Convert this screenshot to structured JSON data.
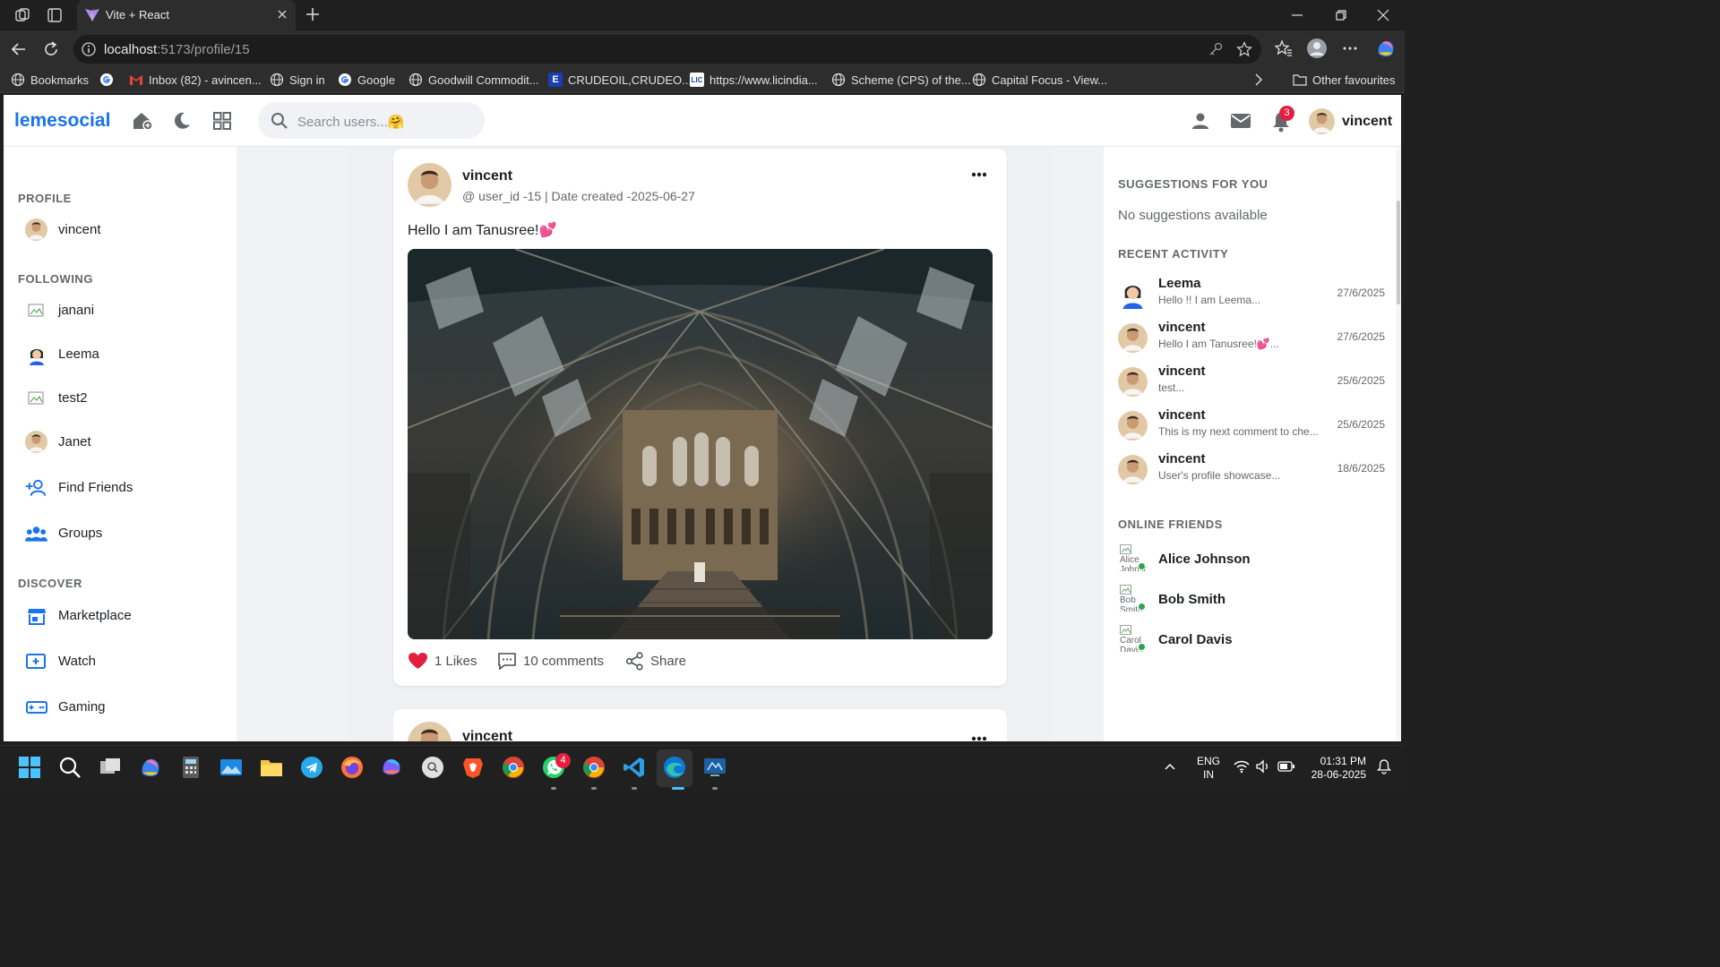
{
  "browser": {
    "tab_title": "Vite + React",
    "url_host": "localhost",
    "url_rest": ":5173/profile/15",
    "bookmarks": [
      {
        "label": "Bookmarks",
        "icon": "globe-icon"
      },
      {
        "label": "",
        "icon": "google-icon"
      },
      {
        "label": "Inbox (82) - avincen...",
        "icon": "gmail-icon"
      },
      {
        "label": "Sign in",
        "icon": "globe-icon"
      },
      {
        "label": "Google",
        "icon": "google-icon"
      },
      {
        "label": "Goodwill Commodit...",
        "icon": "globe-icon"
      },
      {
        "label": "CRUDEOIL,CRUDEO...",
        "icon": "e-icon"
      },
      {
        "label": "https://www.licindia...",
        "icon": "lic-icon"
      },
      {
        "label": "Scheme (CPS) of the...",
        "icon": "globe-icon"
      },
      {
        "label": "Capital Focus - View...",
        "icon": "globe-icon"
      }
    ],
    "other_favourites": "Other favourites"
  },
  "app": {
    "logo": "lemesocial",
    "search_placeholder": "Search users...🤗",
    "notification_count": "3",
    "current_user": "vincent"
  },
  "sidebar": {
    "profile_title": "PROFILE",
    "profile_name": "vincent",
    "following_title": "FOLLOWING",
    "following": [
      "janani",
      "Leema",
      "test2",
      "Janet"
    ],
    "find_friends": "Find Friends",
    "groups": "Groups",
    "discover_title": "DISCOVER",
    "discover": [
      "Marketplace",
      "Watch",
      "Gaming"
    ]
  },
  "post": {
    "author": "vincent",
    "meta": "@ user_id -15 | Date created -2025-06-27",
    "text": "Hello I am Tanusree!💕",
    "likes": "1 Likes",
    "comments": "10 comments",
    "share": "Share",
    "like_color": "#e41e3f"
  },
  "post2": {
    "author": "vincent"
  },
  "right": {
    "suggestions_title": "SUGGESTIONS FOR YOU",
    "no_suggestions": "No suggestions available",
    "activity_title": "RECENT ACTIVITY",
    "activity": [
      {
        "name": "Leema",
        "snippet": "Hello !! I am Leema...",
        "date": "27/6/2025"
      },
      {
        "name": "vincent",
        "snippet": "Hello I am Tanusree!💕...",
        "date": "27/6/2025"
      },
      {
        "name": "vincent",
        "snippet": "test...",
        "date": "25/6/2025"
      },
      {
        "name": "vincent",
        "snippet": "This is my next comment to che...",
        "date": "25/6/2025"
      },
      {
        "name": "vincent",
        "snippet": "User's profile showcase...",
        "date": "18/6/2025"
      }
    ],
    "online_title": "ONLINE FRIENDS",
    "online": [
      {
        "name": "Alice Johnson",
        "alt": "Alice Johnson"
      },
      {
        "name": "Bob Smith",
        "alt": "Bob Smith"
      },
      {
        "name": "Carol Davis",
        "alt": "Carol Davis"
      }
    ]
  },
  "taskbar": {
    "lang_1": "ENG",
    "lang_2": "IN",
    "time": "01:31 PM",
    "date": "28-06-2025",
    "whatsapp_badge": "4"
  },
  "colors": {
    "brand": "#1a73e8",
    "online": "#31a24c",
    "badge": "#e41e3f"
  }
}
